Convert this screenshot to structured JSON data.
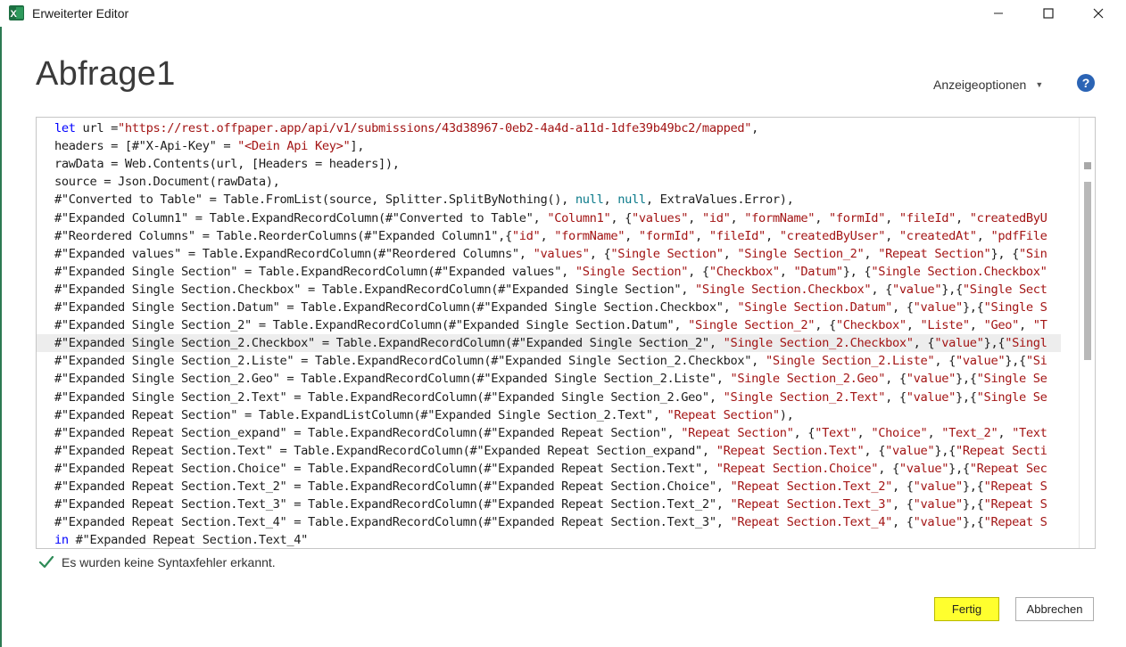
{
  "window": {
    "title": "Erweiterter Editor",
    "icon": "excel-icon"
  },
  "header": {
    "query_name": "Abfrage1",
    "display_options_label": "Anzeigeoptionen",
    "help_label": "?"
  },
  "code": {
    "lines": [
      [
        [
          "kw",
          "let"
        ],
        [
          "t",
          " url ="
        ],
        [
          "st",
          "\"https://rest.offpaper.app/api/v1/submissions/43d38967-0eb2-4a4d-a11d-1dfe39b49bc2/mapped\""
        ],
        [
          "t",
          ","
        ]
      ],
      [
        [
          "t",
          "headers = [#\"X-Api-Key\" = "
        ],
        [
          "st",
          "\"<Dein Api Key>\""
        ],
        [
          "t",
          "],"
        ]
      ],
      [
        [
          "t",
          "rawData = Web.Contents(url, [Headers = headers]),"
        ]
      ],
      [
        [
          "t",
          "source = Json.Document(rawData),"
        ]
      ],
      [
        [
          "t",
          "#\"Converted to Table\" = Table.FromList(source, Splitter.SplitByNothing(), "
        ],
        [
          "nl",
          "null"
        ],
        [
          "t",
          ", "
        ],
        [
          "nl",
          "null"
        ],
        [
          "t",
          ", ExtraValues.Error),"
        ]
      ],
      [
        [
          "t",
          "#\"Expanded Column1\" = Table.ExpandRecordColumn(#\"Converted to Table\", "
        ],
        [
          "st",
          "\"Column1\""
        ],
        [
          "t",
          ", {"
        ],
        [
          "st",
          "\"values\""
        ],
        [
          "t",
          ", "
        ],
        [
          "st",
          "\"id\""
        ],
        [
          "t",
          ", "
        ],
        [
          "st",
          "\"formName\""
        ],
        [
          "t",
          ", "
        ],
        [
          "st",
          "\"formId\""
        ],
        [
          "t",
          ", "
        ],
        [
          "st",
          "\"fileId\""
        ],
        [
          "t",
          ", "
        ],
        [
          "st",
          "\"createdByU"
        ]
      ],
      [
        [
          "t",
          "#\"Reordered Columns\" = Table.ReorderColumns(#\"Expanded Column1\",{"
        ],
        [
          "st",
          "\"id\""
        ],
        [
          "t",
          ", "
        ],
        [
          "st",
          "\"formName\""
        ],
        [
          "t",
          ", "
        ],
        [
          "st",
          "\"formId\""
        ],
        [
          "t",
          ", "
        ],
        [
          "st",
          "\"fileId\""
        ],
        [
          "t",
          ", "
        ],
        [
          "st",
          "\"createdByUser\""
        ],
        [
          "t",
          ", "
        ],
        [
          "st",
          "\"createdAt\""
        ],
        [
          "t",
          ", "
        ],
        [
          "st",
          "\"pdfFile"
        ]
      ],
      [
        [
          "t",
          "#\"Expanded values\" = Table.ExpandRecordColumn(#\"Reordered Columns\", "
        ],
        [
          "st",
          "\"values\""
        ],
        [
          "t",
          ", {"
        ],
        [
          "st",
          "\"Single Section\""
        ],
        [
          "t",
          ", "
        ],
        [
          "st",
          "\"Single Section_2\""
        ],
        [
          "t",
          ", "
        ],
        [
          "st",
          "\"Repeat Section\""
        ],
        [
          "t",
          "}, {"
        ],
        [
          "st",
          "\"Sin"
        ]
      ],
      [
        [
          "t",
          "#\"Expanded Single Section\" = Table.ExpandRecordColumn(#\"Expanded values\", "
        ],
        [
          "st",
          "\"Single Section\""
        ],
        [
          "t",
          ", {"
        ],
        [
          "st",
          "\"Checkbox\""
        ],
        [
          "t",
          ", "
        ],
        [
          "st",
          "\"Datum\""
        ],
        [
          "t",
          "}, {"
        ],
        [
          "st",
          "\"Single Section.Checkbox\""
        ]
      ],
      [
        [
          "t",
          "#\"Expanded Single Section.Checkbox\" = Table.ExpandRecordColumn(#\"Expanded Single Section\", "
        ],
        [
          "st",
          "\"Single Section.Checkbox\""
        ],
        [
          "t",
          ", {"
        ],
        [
          "st",
          "\"value\""
        ],
        [
          "t",
          "},{"
        ],
        [
          "st",
          "\"Single Sect"
        ]
      ],
      [
        [
          "t",
          "#\"Expanded Single Section.Datum\" = Table.ExpandRecordColumn(#\"Expanded Single Section.Checkbox\", "
        ],
        [
          "st",
          "\"Single Section.Datum\""
        ],
        [
          "t",
          ", {"
        ],
        [
          "st",
          "\"value\""
        ],
        [
          "t",
          "},{"
        ],
        [
          "st",
          "\"Single S"
        ]
      ],
      [
        [
          "t",
          "#\"Expanded Single Section_2\" = Table.ExpandRecordColumn(#\"Expanded Single Section.Datum\", "
        ],
        [
          "st",
          "\"Single Section_2\""
        ],
        [
          "t",
          ", {"
        ],
        [
          "st",
          "\"Checkbox\""
        ],
        [
          "t",
          ", "
        ],
        [
          "st",
          "\"Liste\""
        ],
        [
          "t",
          ", "
        ],
        [
          "st",
          "\"Geo\""
        ],
        [
          "t",
          ", "
        ],
        [
          "st",
          "\"T"
        ]
      ],
      [
        [
          "t",
          "#\"Expanded Single Section_2.Checkbox\" = Table.ExpandRecordColumn(#\"Expanded Single Section_2\", "
        ],
        [
          "st",
          "\"Single Section_2.Checkbox\""
        ],
        [
          "t",
          ", {"
        ],
        [
          "st",
          "\"value\""
        ],
        [
          "t",
          "},{"
        ],
        [
          "st",
          "\"Singl"
        ]
      ],
      [
        [
          "t",
          "#\"Expanded Single Section_2.Liste\" = Table.ExpandRecordColumn(#\"Expanded Single Section_2.Checkbox\", "
        ],
        [
          "st",
          "\"Single Section_2.Liste\""
        ],
        [
          "t",
          ", {"
        ],
        [
          "st",
          "\"value\""
        ],
        [
          "t",
          "},{"
        ],
        [
          "st",
          "\"Si"
        ]
      ],
      [
        [
          "t",
          "#\"Expanded Single Section_2.Geo\" = Table.ExpandRecordColumn(#\"Expanded Single Section_2.Liste\", "
        ],
        [
          "st",
          "\"Single Section_2.Geo\""
        ],
        [
          "t",
          ", {"
        ],
        [
          "st",
          "\"value\""
        ],
        [
          "t",
          "},{"
        ],
        [
          "st",
          "\"Single Se"
        ]
      ],
      [
        [
          "t",
          "#\"Expanded Single Section_2.Text\" = Table.ExpandRecordColumn(#\"Expanded Single Section_2.Geo\", "
        ],
        [
          "st",
          "\"Single Section_2.Text\""
        ],
        [
          "t",
          ", {"
        ],
        [
          "st",
          "\"value\""
        ],
        [
          "t",
          "},{"
        ],
        [
          "st",
          "\"Single Se"
        ]
      ],
      [
        [
          "t",
          "#\"Expanded Repeat Section\" = Table.ExpandListColumn(#\"Expanded Single Section_2.Text\", "
        ],
        [
          "st",
          "\"Repeat Section\""
        ],
        [
          "t",
          "),"
        ]
      ],
      [
        [
          "t",
          "#\"Expanded Repeat Section_expand\" = Table.ExpandRecordColumn(#\"Expanded Repeat Section\", "
        ],
        [
          "st",
          "\"Repeat Section\""
        ],
        [
          "t",
          ", {"
        ],
        [
          "st",
          "\"Text\""
        ],
        [
          "t",
          ", "
        ],
        [
          "st",
          "\"Choice\""
        ],
        [
          "t",
          ", "
        ],
        [
          "st",
          "\"Text_2\""
        ],
        [
          "t",
          ", "
        ],
        [
          "st",
          "\"Text"
        ]
      ],
      [
        [
          "t",
          "#\"Expanded Repeat Section.Text\" = Table.ExpandRecordColumn(#\"Expanded Repeat Section_expand\", "
        ],
        [
          "st",
          "\"Repeat Section.Text\""
        ],
        [
          "t",
          ", {"
        ],
        [
          "st",
          "\"value\""
        ],
        [
          "t",
          "},{"
        ],
        [
          "st",
          "\"Repeat Secti"
        ]
      ],
      [
        [
          "t",
          "#\"Expanded Repeat Section.Choice\" = Table.ExpandRecordColumn(#\"Expanded Repeat Section.Text\", "
        ],
        [
          "st",
          "\"Repeat Section.Choice\""
        ],
        [
          "t",
          ", {"
        ],
        [
          "st",
          "\"value\""
        ],
        [
          "t",
          "},{"
        ],
        [
          "st",
          "\"Repeat Sec"
        ]
      ],
      [
        [
          "t",
          "#\"Expanded Repeat Section.Text_2\" = Table.ExpandRecordColumn(#\"Expanded Repeat Section.Choice\", "
        ],
        [
          "st",
          "\"Repeat Section.Text_2\""
        ],
        [
          "t",
          ", {"
        ],
        [
          "st",
          "\"value\""
        ],
        [
          "t",
          "},{"
        ],
        [
          "st",
          "\"Repeat S"
        ]
      ],
      [
        [
          "t",
          "#\"Expanded Repeat Section.Text_3\" = Table.ExpandRecordColumn(#\"Expanded Repeat Section.Text_2\", "
        ],
        [
          "st",
          "\"Repeat Section.Text_3\""
        ],
        [
          "t",
          ", {"
        ],
        [
          "st",
          "\"value\""
        ],
        [
          "t",
          "},{"
        ],
        [
          "st",
          "\"Repeat S"
        ]
      ],
      [
        [
          "t",
          "#\"Expanded Repeat Section.Text_4\" = Table.ExpandRecordColumn(#\"Expanded Repeat Section.Text_3\", "
        ],
        [
          "st",
          "\"Repeat Section.Text_4\""
        ],
        [
          "t",
          ", {"
        ],
        [
          "st",
          "\"value\""
        ],
        [
          "t",
          "},{"
        ],
        [
          "st",
          "\"Repeat S"
        ]
      ],
      [
        [
          "kw",
          "in"
        ],
        [
          "t",
          " #\"Expanded Repeat Section.Text_4\""
        ]
      ]
    ],
    "current_line_index": 12
  },
  "status": {
    "message": "Es wurden keine Syntaxfehler erkannt.",
    "icon": "checkmark-icon",
    "color": "#2e8b57"
  },
  "buttons": {
    "done_label": "Fertig",
    "cancel_label": "Abbrechen",
    "done_highlight": "#ffff2e"
  },
  "colors": {
    "keyword": "#0000ff",
    "string": "#a31515",
    "null_literal": "#0b7a8a",
    "excel_green": "#1d6f42"
  }
}
